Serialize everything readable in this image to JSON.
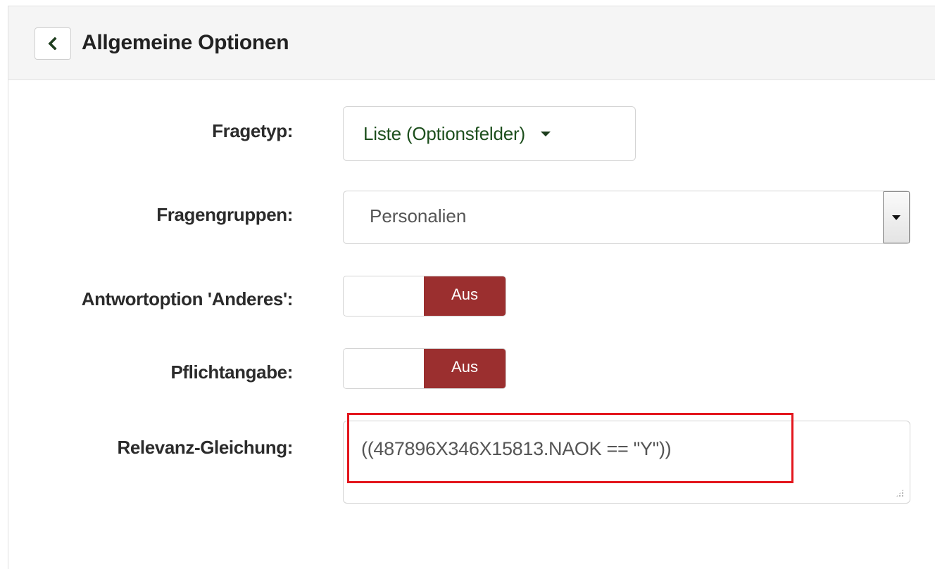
{
  "panel": {
    "title": "Allgemeine Optionen"
  },
  "form": {
    "fragetyp": {
      "label": "Fragetyp:",
      "value": "Liste (Optionsfelder)"
    },
    "fragengruppen": {
      "label": "Fragengruppen:",
      "value": "Personalien"
    },
    "anderes": {
      "label": "Antwortoption 'Anderes':",
      "state": "Aus"
    },
    "pflicht": {
      "label": "Pflichtangabe:",
      "state": "Aus"
    },
    "relevanz": {
      "label": "Relevanz-Gleichung:",
      "value": "((487896X346X15813.NAOK == \"Y\"))"
    }
  },
  "icons": {
    "back": "chevron-left-icon",
    "dropdown": "caret-down-icon",
    "select_arrow": "select-arrow-icon",
    "resize": "resize-grip-icon"
  },
  "colors": {
    "toggle_off": "#9b2f2f",
    "fragetyp_text": "#1d4f1d",
    "highlight": "#e3161d"
  }
}
